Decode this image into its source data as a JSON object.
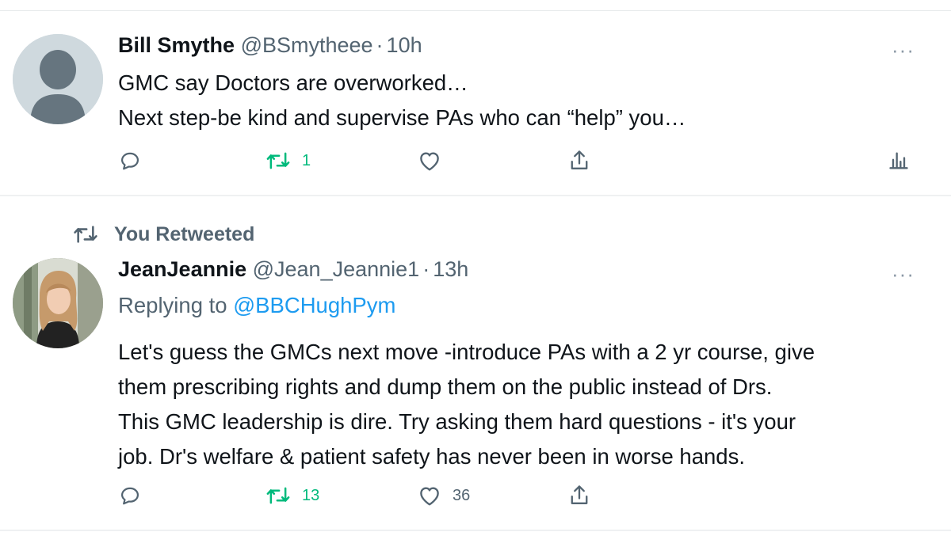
{
  "tweets": [
    {
      "author": "Bill Smythe",
      "handle": "@BSmytheee",
      "separator": "·",
      "time": "10h",
      "lines": [
        "GMC say Doctors are overworked…",
        "Next step-be kind and supervise PAs who can “help” you…"
      ],
      "retweet_count": "1",
      "like_count": "",
      "more_icon": "ellipsis-icon"
    },
    {
      "retweeted_label": "You Retweeted",
      "author": "JeanJeannie",
      "handle": "@Jean_Jeannie1",
      "separator": "·",
      "time": "13h",
      "replying_prefix": "Replying to",
      "replying_to": "@BBCHughPym",
      "lines": [
        "Let's guess the GMCs next move -introduce PAs with a 2 yr course, give",
        "them prescribing rights and dump them on the public instead of Drs.",
        "This GMC leadership is dire. Try asking them hard questions - it's your",
        "job. Dr's welfare & patient safety has never been in worse hands."
      ],
      "retweet_count": "13",
      "like_count": "36",
      "more_icon": "ellipsis-icon"
    }
  ],
  "colors": {
    "text": "#0f1419",
    "muted": "#536471",
    "link": "#1d9bf0",
    "retweet_green": "#00ba7c",
    "divider": "#eff1f2"
  }
}
